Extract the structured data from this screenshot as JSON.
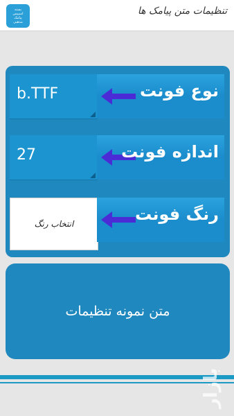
{
  "header": {
    "title": "تنظیمات متن پیامک ها",
    "icon": "app-logo-icon",
    "icon_lines": [
      "بسته",
      "اسپیس",
      "پیامک",
      "مذهبی"
    ]
  },
  "settings": {
    "font_type": {
      "label": "نوع فونت",
      "value": "b.TTF"
    },
    "font_size": {
      "label": "اندازه فونت",
      "value": "27"
    },
    "font_color": {
      "label": "رنگ فونت",
      "button_label": "انتخاب رنگ"
    }
  },
  "preview": {
    "text": "متن نمونه تنظیمات"
  },
  "watermark": "بازار",
  "colors": {
    "panel": "#1f88bf",
    "label_button": "#1b8ccc",
    "arrow": "#4a2bd6",
    "background": "#e6e6e6",
    "footer_line": "#1a9ac4"
  }
}
